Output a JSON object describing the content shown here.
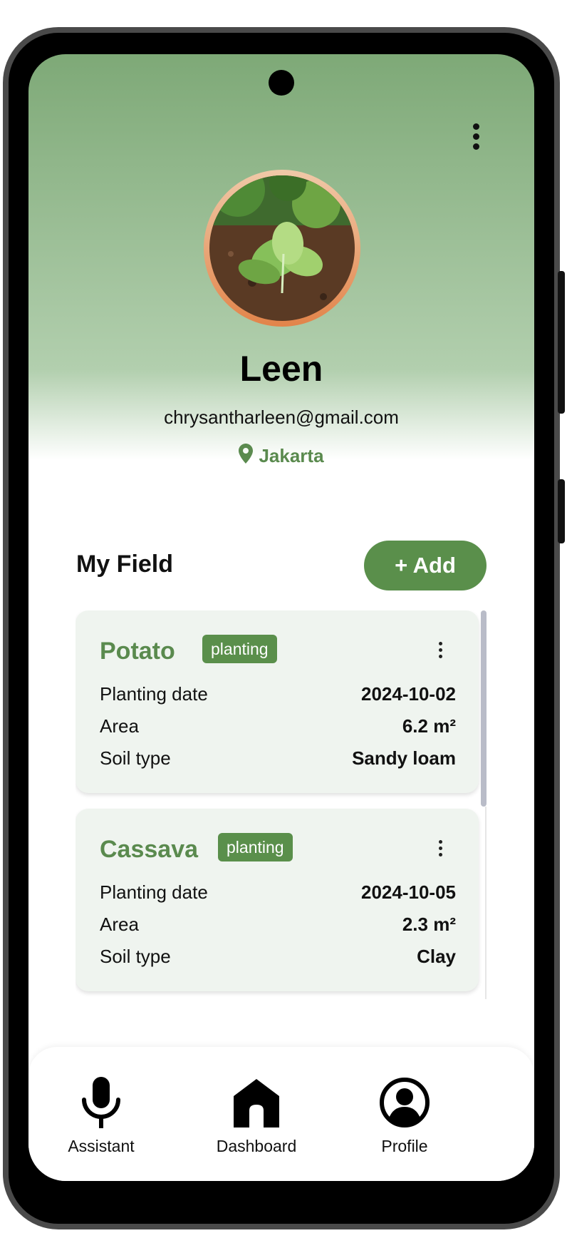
{
  "profile": {
    "name": "Leen",
    "email": "chrysantharleen@gmail.com",
    "location": "Jakarta"
  },
  "fields": {
    "title": "My Field",
    "add_label": "+ Add",
    "items": [
      {
        "name": "Potato",
        "status": "planting",
        "planting_date_label": "Planting date",
        "planting_date": "2024-10-02",
        "area_label": "Area",
        "area": "6.2 m²",
        "soil_label": "Soil type",
        "soil": "Sandy loam"
      },
      {
        "name": "Cassava",
        "status": "planting",
        "planting_date_label": "Planting date",
        "planting_date": "2024-10-05",
        "area_label": "Area",
        "area": "2.3 m²",
        "soil_label": "Soil type",
        "soil": "Clay"
      }
    ]
  },
  "nav": {
    "items": [
      {
        "label": "Assistant",
        "icon": "microphone-icon"
      },
      {
        "label": "Dashboard",
        "icon": "home-icon"
      },
      {
        "label": "Profile",
        "icon": "profile-icon"
      }
    ]
  },
  "colors": {
    "accent": "#5a8f4b",
    "header_gradient_top": "#7ea977",
    "card_background": "#eff4ef"
  }
}
